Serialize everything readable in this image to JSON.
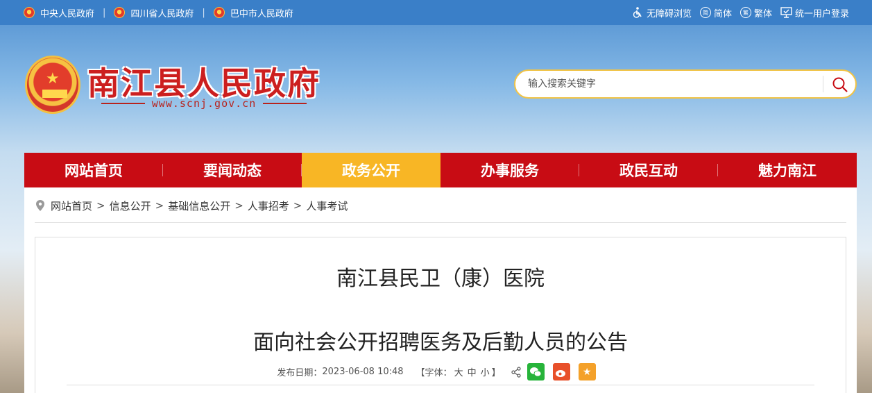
{
  "topbar": {
    "links": [
      {
        "label": "中央人民政府",
        "icon": "emblem-icon"
      },
      {
        "label": "四川省人民政府",
        "icon": "emblem-icon"
      },
      {
        "label": "巴中市人民政府",
        "icon": "emblem-icon"
      }
    ],
    "separator": "|",
    "tools": [
      {
        "label": "无障碍浏览",
        "icon": "wheelchair-icon"
      },
      {
        "label": "简体",
        "icon": "simplified-icon"
      },
      {
        "label": "繁体",
        "icon": "traditional-icon"
      },
      {
        "label": "统一用户登录",
        "icon": "monitor-icon"
      }
    ]
  },
  "header": {
    "title": "南江县人民政府",
    "url": "www.scnj.gov.cn",
    "search_placeholder": "输入搜索关键字"
  },
  "nav": {
    "items": [
      {
        "label": "网站首页"
      },
      {
        "label": "要闻动态"
      },
      {
        "label": "政务公开"
      },
      {
        "label": "办事服务"
      },
      {
        "label": "政民互动"
      },
      {
        "label": "魅力南江"
      }
    ],
    "active": "政务公开"
  },
  "breadcrumb": {
    "items": [
      "网站首页",
      "信息公开",
      "基础信息公开",
      "人事招考",
      "人事考试"
    ],
    "arrow": ">"
  },
  "article": {
    "title_line1": "南江县民卫（康）医院",
    "title_line2": "面向社会公开招聘医务及后勤人员的公告",
    "date_label": "发布日期：",
    "date": "2023-06-08 10:48",
    "font_label": "【字体：",
    "font_sizes": [
      "大",
      "中",
      "小"
    ],
    "font_close": "】"
  },
  "colors": {
    "nav_bg": "#c80c14",
    "nav_active": "#f8b625",
    "title_red": "#cc1f1f",
    "topbar_bg": "#3a7fc8",
    "search_border": "#f1c345"
  }
}
